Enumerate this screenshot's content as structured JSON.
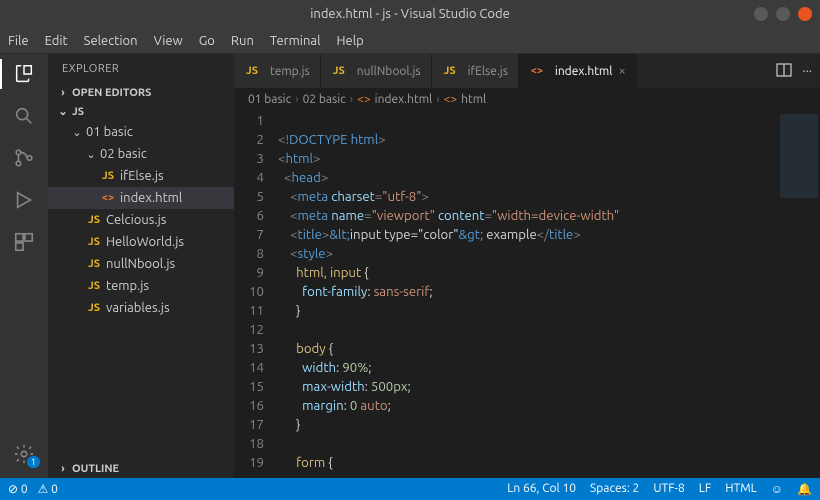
{
  "window": {
    "title": "index.html - js - Visual Studio Code"
  },
  "menu": [
    "File",
    "Edit",
    "Selection",
    "View",
    "Go",
    "Run",
    "Terminal",
    "Help"
  ],
  "activity_badge": "1",
  "sidebar": {
    "header": "EXPLORER",
    "open_editors": "OPEN EDITORS",
    "project": "JS",
    "outline": "OUTLINE",
    "tree": {
      "f1": "01 basic",
      "f2": "02 basic",
      "ifelse": "ifElse.js",
      "index": "index.html",
      "celcious": "Celcious.js",
      "hello": "HelloWorld.js",
      "nullnb": "nullNbool.js",
      "temp": "temp.js",
      "vars": "variables.js"
    }
  },
  "tabs": {
    "t1": "temp.js",
    "t2": "nullNbool.js",
    "t3": "ifElse.js",
    "t4": "index.html"
  },
  "breadcrumb": {
    "p1": "01 basic",
    "p2": "02 basic",
    "p3": "index.html",
    "p4": "html"
  },
  "gutter": [
    "1",
    "2",
    "3",
    "4",
    "5",
    "6",
    "7",
    "8",
    "9",
    "10",
    "11",
    "12",
    "13",
    "14",
    "15",
    "16",
    "17",
    "18",
    "19"
  ],
  "status": {
    "errors": "0",
    "warnings": "0",
    "lncol": "Ln 66, Col 10",
    "spaces": "Spaces: 2",
    "enc": "UTF-8",
    "eol": "LF",
    "lang": "HTML"
  },
  "code": {
    "doctype": "DOCTYPE html",
    "html_open": "html",
    "head": "head",
    "meta1_attr": "charset",
    "meta1_val": "\"utf-8\"",
    "meta2_name": "name",
    "meta2_name_v": "\"viewport\"",
    "meta2_content": "content",
    "meta2_content_v": "\"width=device-width\"",
    "title": "title",
    "title_ent1": "&lt;",
    "title_txt": "input type=\"color\"",
    "title_ent2": "&gt;",
    "title_rest": " example",
    "style": "style",
    "sel1": "html, input",
    "prop_ff": "font-family",
    "val_ff": "sans-serif",
    "sel_body": "body",
    "prop_w": "width",
    "val_w": "90%",
    "prop_mw": "max-width",
    "num_500": "500px",
    "prop_m": "margin",
    "num_0": "0",
    "val_auto": "auto",
    "sel_form": "form"
  }
}
